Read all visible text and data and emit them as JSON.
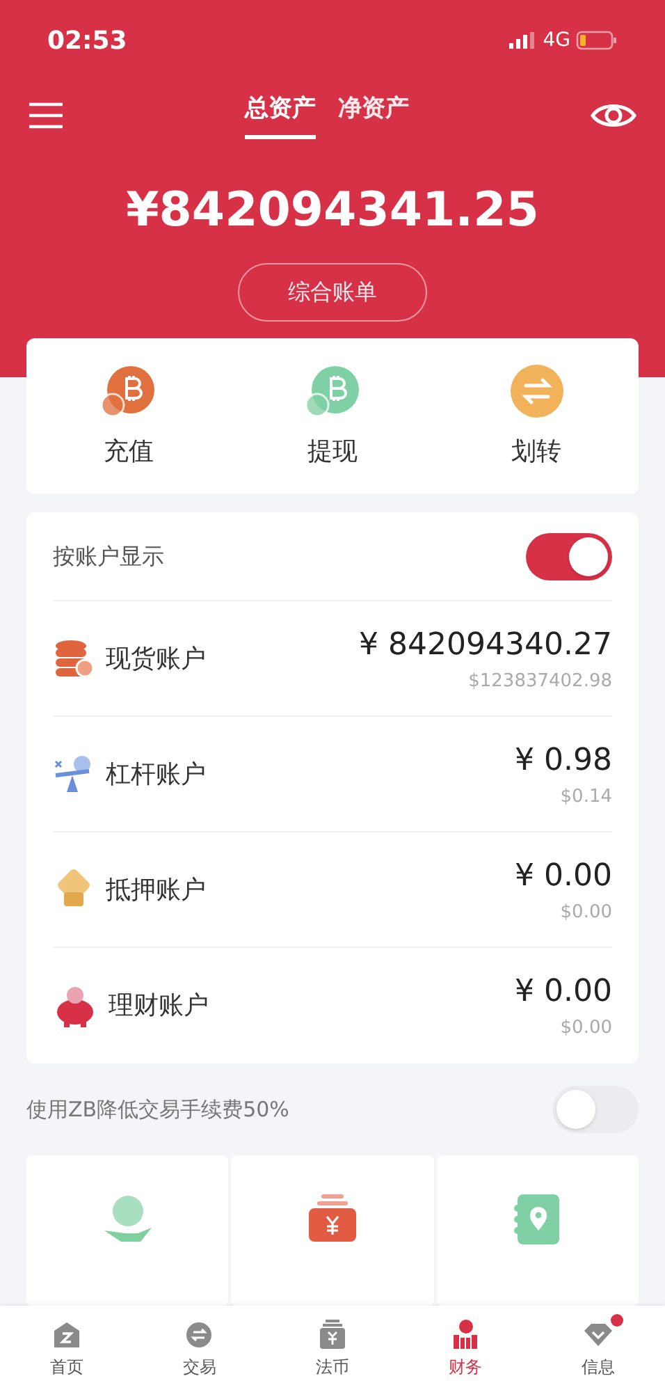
{
  "status_bar": {
    "time": "02:53",
    "network": "4G"
  },
  "header": {
    "tabs": [
      {
        "label": "总资产",
        "selected": true
      },
      {
        "label": "净资产",
        "selected": false
      }
    ],
    "total": "¥842094341.25",
    "statement_button": "综合账单"
  },
  "actions": [
    {
      "label": "充值",
      "kind": "deposit"
    },
    {
      "label": "提现",
      "kind": "withdraw"
    },
    {
      "label": "划转",
      "kind": "transfer"
    }
  ],
  "accounts": {
    "toggle_label": "按账户显示",
    "toggle_on": true,
    "items": [
      {
        "kind": "spot",
        "name": "现货账户",
        "cny": "¥ 842094340.27",
        "usd": "$123837402.98"
      },
      {
        "kind": "leverage",
        "name": "杠杆账户",
        "cny": "¥ 0.98",
        "usd": "$0.14"
      },
      {
        "kind": "pledge",
        "name": "抵押账户",
        "cny": "¥ 0.00",
        "usd": "$0.00"
      },
      {
        "kind": "finance",
        "name": "理财账户",
        "cny": "¥ 0.00",
        "usd": "$0.00"
      }
    ]
  },
  "fee_toggle": {
    "label": "使用ZB降低交易手续费50%",
    "on": false
  },
  "tiles": [
    {
      "kind": "loan"
    },
    {
      "kind": "fiat"
    },
    {
      "kind": "address"
    }
  ],
  "tab_bar": {
    "items": [
      {
        "kind": "home",
        "label": "首页",
        "selected": false,
        "badge": false
      },
      {
        "kind": "trade",
        "label": "交易",
        "selected": false,
        "badge": false
      },
      {
        "kind": "fiat",
        "label": "法币",
        "selected": false,
        "badge": false
      },
      {
        "kind": "finance",
        "label": "财务",
        "selected": true,
        "badge": false
      },
      {
        "kind": "info",
        "label": "信息",
        "selected": false,
        "badge": true
      }
    ]
  }
}
